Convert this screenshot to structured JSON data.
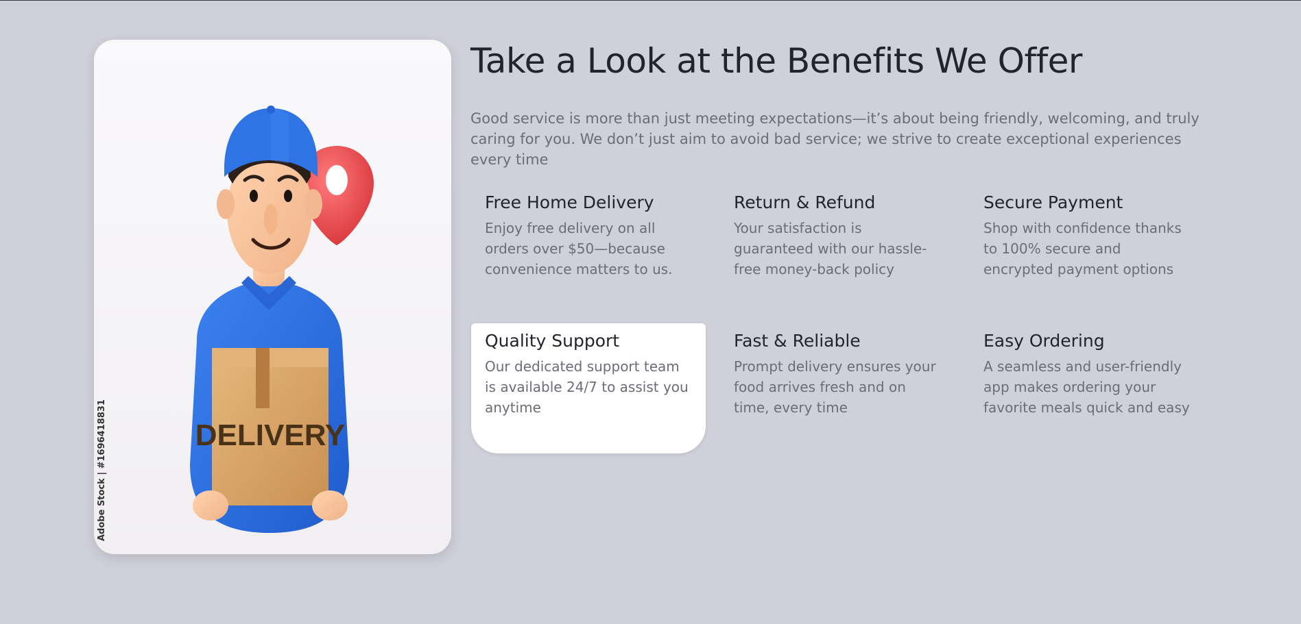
{
  "hero_image": {
    "box_label": "DELIVERY",
    "watermark": "Adobe Stock | #1696418831"
  },
  "section": {
    "title": "Take a Look at the Benefits We Offer",
    "intro": "Good service is more than just meeting expectations—it’s about being friendly, welcoming, and truly caring for you. We don’t just aim to avoid bad service; we strive to create exceptional experiences every time"
  },
  "features": [
    {
      "title": "Free Home Delivery",
      "text": "Enjoy free delivery on all orders over $50—because convenience matters to us."
    },
    {
      "title": "Return & Refund",
      "text": "Your satisfaction is guaranteed with our hassle-free money-back policy"
    },
    {
      "title": "Secure Payment",
      "text": "Shop with confidence thanks to 100% secure and encrypted payment options"
    },
    {
      "title": "Quality Support",
      "text": "Our dedicated support team is available 24/7 to assist you anytime"
    },
    {
      "title": "Fast & Reliable",
      "text": "Prompt delivery ensures your food arrives fresh and on time, every time"
    },
    {
      "title": "Easy Ordering",
      "text": "A seamless and user-friendly app makes ordering your favorite meals quick and easy"
    }
  ],
  "colors": {
    "page_background": "#d0d0da",
    "heading": "#23232d",
    "body_text": "#6c6c78",
    "cap_blue": "#2f6fe0",
    "pin_red": "#e5484d",
    "box_tan": "#d9a868"
  }
}
